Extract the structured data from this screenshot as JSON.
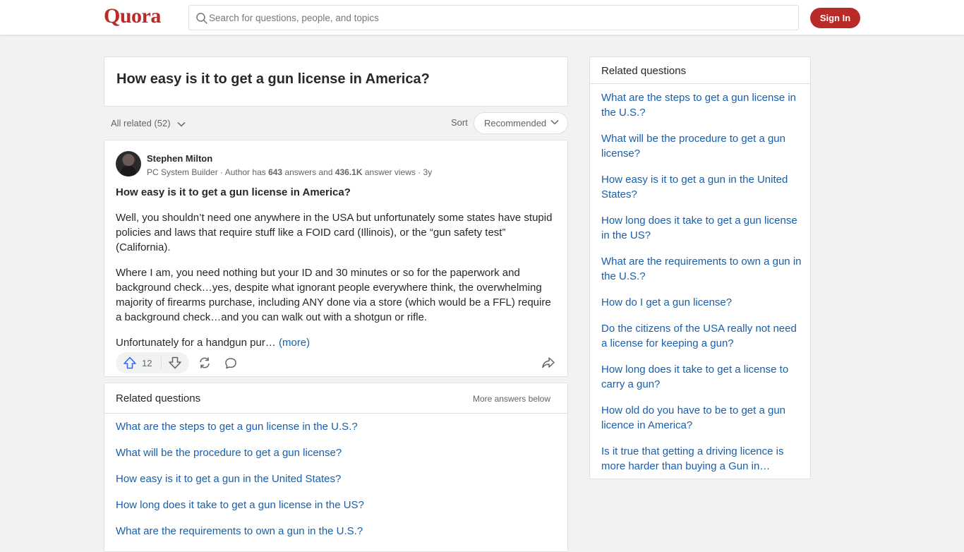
{
  "header": {
    "logo": "Quora",
    "search_placeholder": "Search for questions, people, and topics",
    "signin_label": "Sign In"
  },
  "question": {
    "title": "How easy is it to get a gun license in America?"
  },
  "filters": {
    "all_related": "All related (52)",
    "sort_label": "Sort",
    "sort_value": "Recommended"
  },
  "answer": {
    "author": "Stephen Milton",
    "meta_prefix": "PC System Builder · Author has ",
    "answers_count": "643",
    "meta_mid": " answers and ",
    "views_count": "436.1K",
    "meta_suffix": " answer views · 3y",
    "question": "How easy is it to get a gun license in America?",
    "paragraphs": [
      "Well, you shouldn’t need one anywhere in the USA but unfortunately some states have stupid policies and laws that require stuff like a FOID card (Illinois), or the “gun safety test” (California).",
      "Where I am, you need nothing but your ID and 30 minutes or so for the paperwork and background check…yes, despite what ignorant people everywhere think, the overwhelming majority of firearms purchase, including ANY done via a store (which would be a FFL) require a background check…and you can walk out with a shotgun or rifle.",
      "Unfortunately for a handgun pur…"
    ],
    "more_label": "(more)",
    "upvotes": "12"
  },
  "inline_related": {
    "title": "Related questions",
    "more_label": "More answers below",
    "items": [
      "What are the steps to get a gun license in the U.S.?",
      "What will be the procedure to get a gun license?",
      "How easy is it to get a gun in the United States?",
      "How long does it take to get a gun license in the US?",
      "What are the requirements to own a gun in the U.S.?"
    ]
  },
  "sidebar_related": {
    "title": "Related questions",
    "items": [
      "What are the steps to get a gun license in the U.S.?",
      "What will be the procedure to get a gun license?",
      "How easy is it to get a gun in the United States?",
      "How long does it take to get a gun license in the US?",
      "What are the requirements to own a gun in the U.S.?",
      "How do I get a gun license?",
      "Do the citizens of the USA really not need a license for keeping a gun?",
      "How long does it take to get a license to carry a gun?",
      "How old do you have to be to get a gun licence in America?",
      "Is it true that getting a driving licence is more harder than buying a Gun in…"
    ]
  },
  "colors": {
    "brand": "#b92b27",
    "link": "#195faa",
    "background": "#f1f2f2"
  },
  "icons": [
    "search-icon",
    "chevron-down-icon",
    "upvote-icon",
    "downvote-icon",
    "reshare-icon",
    "comment-icon",
    "share-icon"
  ]
}
